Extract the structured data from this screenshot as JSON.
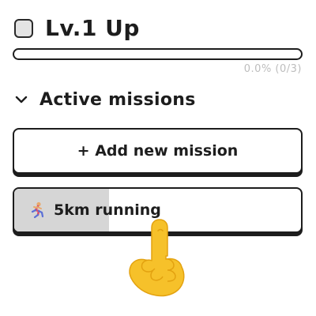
{
  "level": {
    "title": "Lv.1 Up",
    "checked": false
  },
  "progress": {
    "fraction": 0.0,
    "text": "0.0% (0/3)"
  },
  "section": {
    "title": "Active missions",
    "expanded": true,
    "icon": "chevron-down-icon"
  },
  "add_button": {
    "label": "+ Add new mission"
  },
  "missions": [
    {
      "icon": "runner-icon",
      "label": "5km running",
      "progress_fraction": 0.33
    }
  ],
  "cursor": {
    "icon": "pointing-hand-icon"
  },
  "colors": {
    "text": "#1d1d1d",
    "muted": "#bdbdbd",
    "mission_fill": "#d6d6d6",
    "hand": "#f6c12a"
  }
}
